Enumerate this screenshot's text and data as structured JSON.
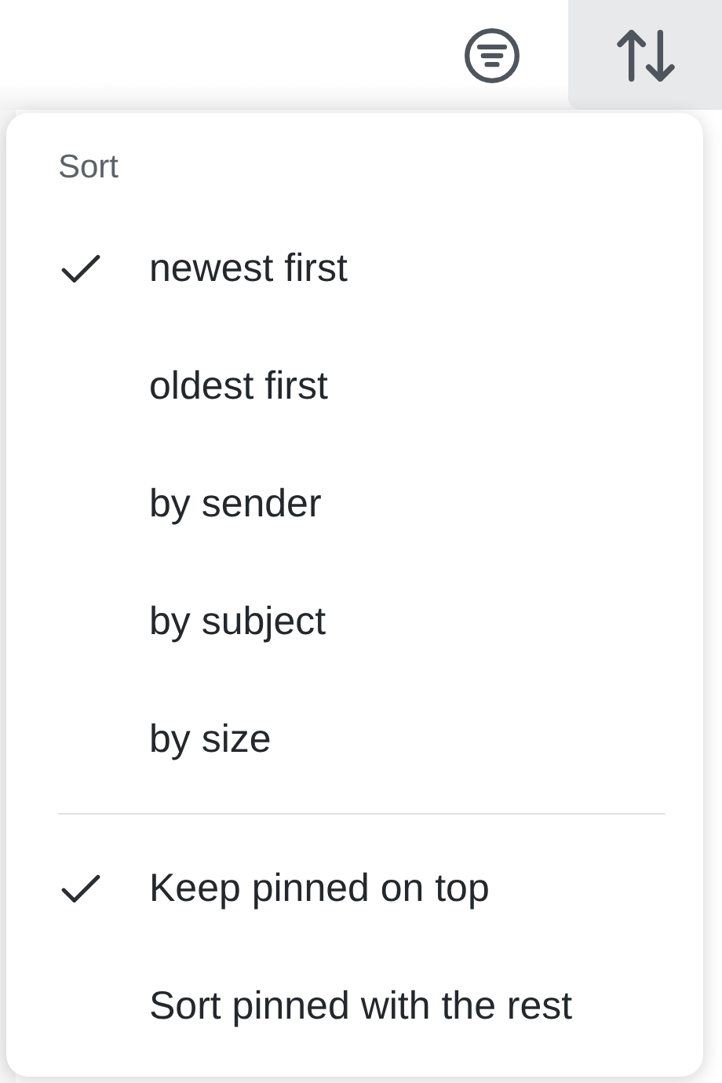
{
  "toolbar": {
    "buttons": [
      {
        "kind": "filter",
        "selected": false
      },
      {
        "kind": "sort",
        "selected": true
      }
    ]
  },
  "menu": {
    "title": "Sort",
    "sections": [
      {
        "items": [
          {
            "label": "newest first",
            "selected": true
          },
          {
            "label": "oldest first",
            "selected": false
          },
          {
            "label": "by sender",
            "selected": false
          },
          {
            "label": "by subject",
            "selected": false
          },
          {
            "label": "by size",
            "selected": false
          }
        ]
      },
      {
        "items": [
          {
            "label": "Keep pinned on top",
            "selected": true
          },
          {
            "label": "Sort pinned with the rest",
            "selected": false
          }
        ]
      }
    ]
  }
}
